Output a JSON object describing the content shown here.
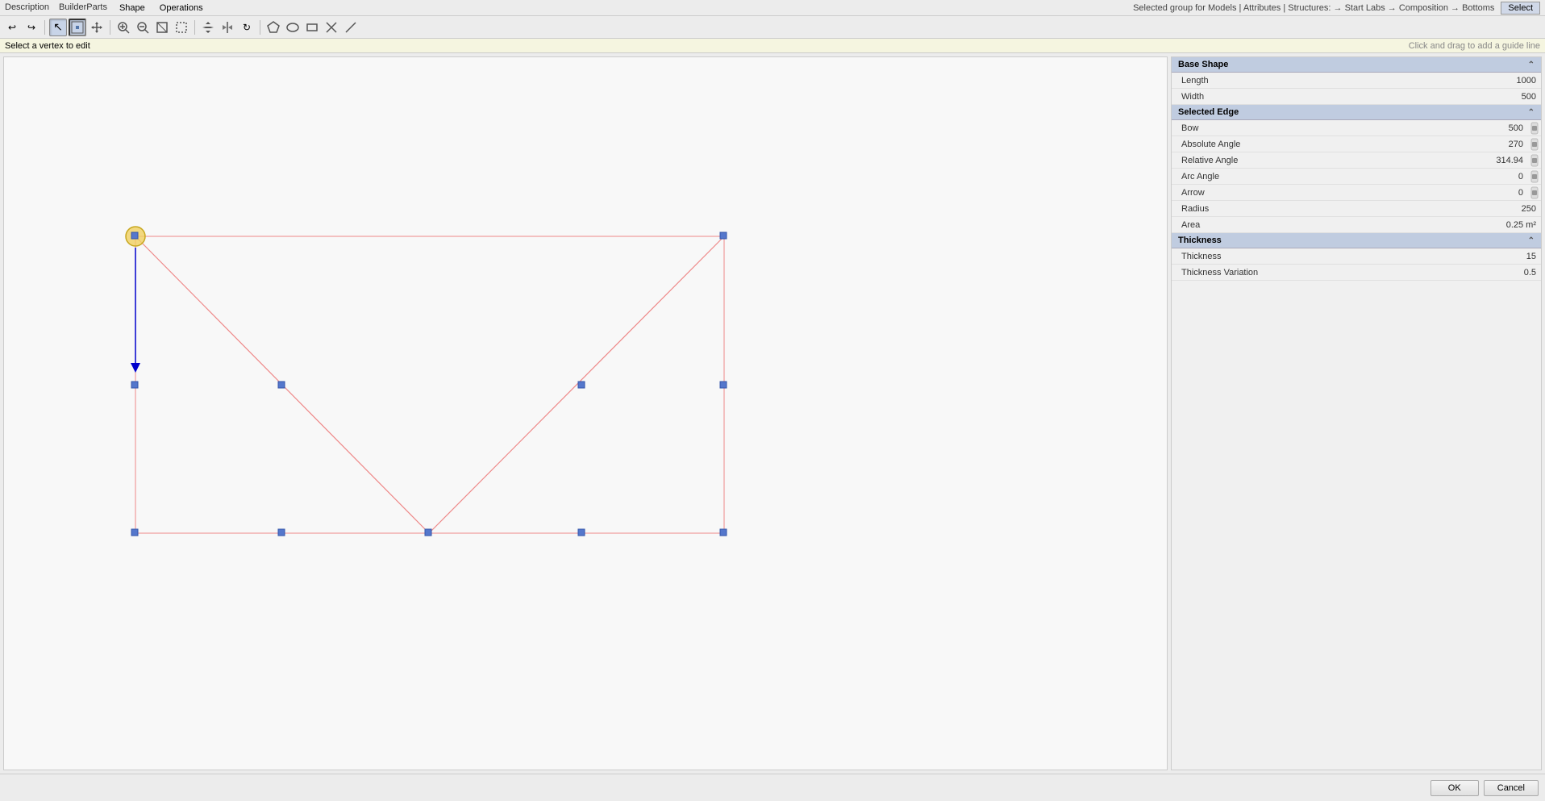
{
  "topBar": {
    "description": "Description",
    "appTitle": "BuilderParts",
    "menuItems": [
      "Shape",
      "Operations"
    ],
    "breadcrumb": "Selected group for Models | Attributes | Structures: → Start Labs → Composition → Bottoms",
    "selectBtn": "Select"
  },
  "statusBar": {
    "hint": "Select a vertex to edit",
    "guideHint": "Click and drag to add a guide line"
  },
  "toolbar": {
    "buttons": [
      {
        "name": "undo",
        "icon": "↩",
        "label": "Undo"
      },
      {
        "name": "redo",
        "icon": "↪",
        "label": "Redo"
      },
      {
        "name": "cursor",
        "icon": "↖",
        "label": "Cursor",
        "active": true
      },
      {
        "name": "select-vertex",
        "icon": "⊡",
        "label": "Select Vertex",
        "active": true
      },
      {
        "name": "move",
        "icon": "✛",
        "label": "Move"
      },
      {
        "name": "zoom-in",
        "icon": "⊕",
        "label": "Zoom In"
      },
      {
        "name": "zoom-out",
        "icon": "⊖",
        "label": "Zoom Out"
      },
      {
        "name": "zoom-fit",
        "icon": "⊞",
        "label": "Zoom Fit"
      },
      {
        "name": "zoom-window",
        "icon": "⊟",
        "label": "Zoom Window"
      },
      {
        "name": "pan",
        "icon": "✥",
        "label": "Pan"
      },
      {
        "name": "mirror",
        "icon": "⇔",
        "label": "Mirror"
      },
      {
        "name": "rotate",
        "icon": "↻",
        "label": "Rotate"
      },
      {
        "name": "shape-tool1",
        "icon": "◇",
        "label": "Shape Tool 1"
      },
      {
        "name": "shape-tool2",
        "icon": "◈",
        "label": "Shape Tool 2"
      },
      {
        "name": "rect",
        "icon": "▭",
        "label": "Rectangle"
      },
      {
        "name": "cut",
        "icon": "✂",
        "label": "Cut"
      },
      {
        "name": "line-tool",
        "icon": "╱",
        "label": "Line Tool"
      }
    ]
  },
  "canvas": {
    "backgroundColor": "#f8f8f8"
  },
  "rightPanel": {
    "sections": [
      {
        "name": "Base Shape",
        "rows": [
          {
            "label": "Length",
            "value": "1000",
            "hasScroll": false
          },
          {
            "label": "Width",
            "value": "500",
            "hasScroll": false
          }
        ]
      },
      {
        "name": "Selected Edge",
        "rows": [
          {
            "label": "Bow",
            "value": "500",
            "hasScroll": true
          },
          {
            "label": "Absolute Angle",
            "value": "270",
            "hasScroll": true
          },
          {
            "label": "Relative Angle",
            "value": "314.94",
            "hasScroll": true
          },
          {
            "label": "Arc Angle",
            "value": "0",
            "hasScroll": true
          },
          {
            "label": "Arrow",
            "value": "0",
            "hasScroll": true
          },
          {
            "label": "Radius",
            "value": "250",
            "hasScroll": false
          },
          {
            "label": "Area",
            "value": "0.25 m²",
            "hasScroll": false
          }
        ]
      },
      {
        "name": "Thickness",
        "rows": [
          {
            "label": "Thickness",
            "value": "15",
            "hasScroll": false
          },
          {
            "label": "Thickness Variation",
            "value": "0.5",
            "hasScroll": false
          }
        ]
      }
    ]
  },
  "bottomBar": {
    "okBtn": "OK",
    "cancelBtn": "Cancel"
  }
}
